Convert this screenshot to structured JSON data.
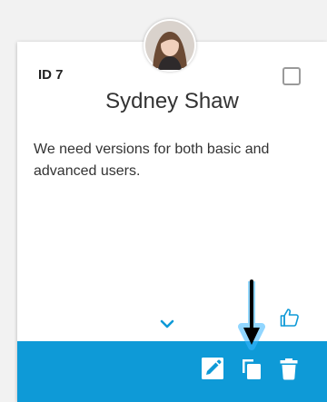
{
  "card": {
    "id_label": "ID 7",
    "name": "Sydney Shaw",
    "description": "We need versions for both basic and advanced users."
  },
  "icons": {
    "avatar": "user-photo",
    "checkbox": "checkbox-icon",
    "expand": "chevron-down-icon",
    "like": "thumbs-up-icon",
    "edit": "pencil-icon",
    "copy": "copy-icon",
    "delete": "trash-icon",
    "pointer": "arrow-down-icon"
  },
  "colors": {
    "action_bar": "#0e9ad7",
    "accent": "#0e9ad7",
    "arrow_glow": "#38b6ff"
  }
}
